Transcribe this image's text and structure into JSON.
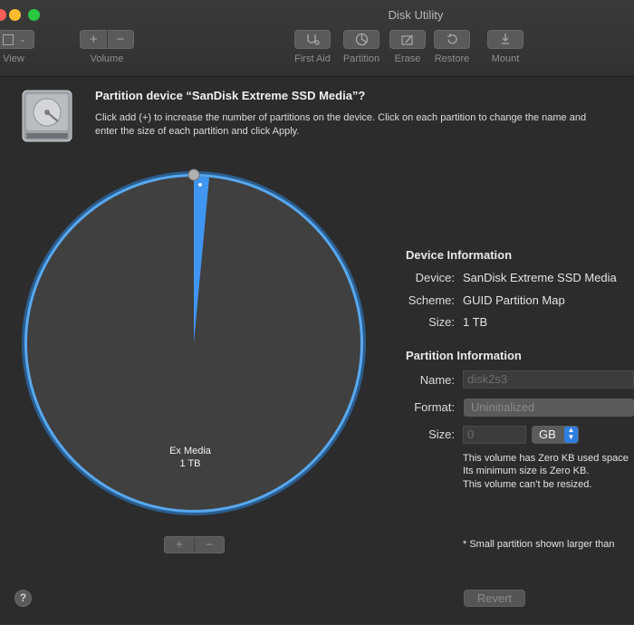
{
  "window": {
    "title": "Disk Utility"
  },
  "toolbar": {
    "view_label": "View",
    "volume_label": "Volume",
    "volume_add": "+",
    "volume_remove": "−",
    "first_aid_label": "First Aid",
    "partition_label": "Partition",
    "erase_label": "Erase",
    "restore_label": "Restore",
    "mount_label": "Mount"
  },
  "header": {
    "title": "Partition device “SanDisk Extreme SSD Media”?",
    "description_line1": "Click add (+) to increase the number of partitions on the device. Click on each partition to change the name and",
    "description_line2": "enter the size of each partition and click Apply."
  },
  "pie": {
    "partition_name": "Ex Media",
    "partition_size": "1 TB",
    "add_label": "+",
    "remove_label": "−",
    "accent_color": "#2f8fe8"
  },
  "device_info": {
    "title": "Device Information",
    "device_label": "Device:",
    "device_value": "SanDisk Extreme SSD Media",
    "scheme_label": "Scheme:",
    "scheme_value": "GUID Partition Map",
    "size_label": "Size:",
    "size_value": "1 TB"
  },
  "partition_info": {
    "title": "Partition Information",
    "name_label": "Name:",
    "name_value": "disk2s3",
    "format_label": "Format:",
    "format_value": "Uninitialized",
    "size_label": "Size:",
    "size_value": "0",
    "unit_value": "GB",
    "note_line1": "This volume has Zero KB used space",
    "note_line2": "Its minimum size is Zero KB.",
    "note_line3": "This volume can’t be resized."
  },
  "footer": {
    "small_partition_note": "* Small partition shown larger than",
    "revert_label": "Revert",
    "help_label": "?"
  }
}
